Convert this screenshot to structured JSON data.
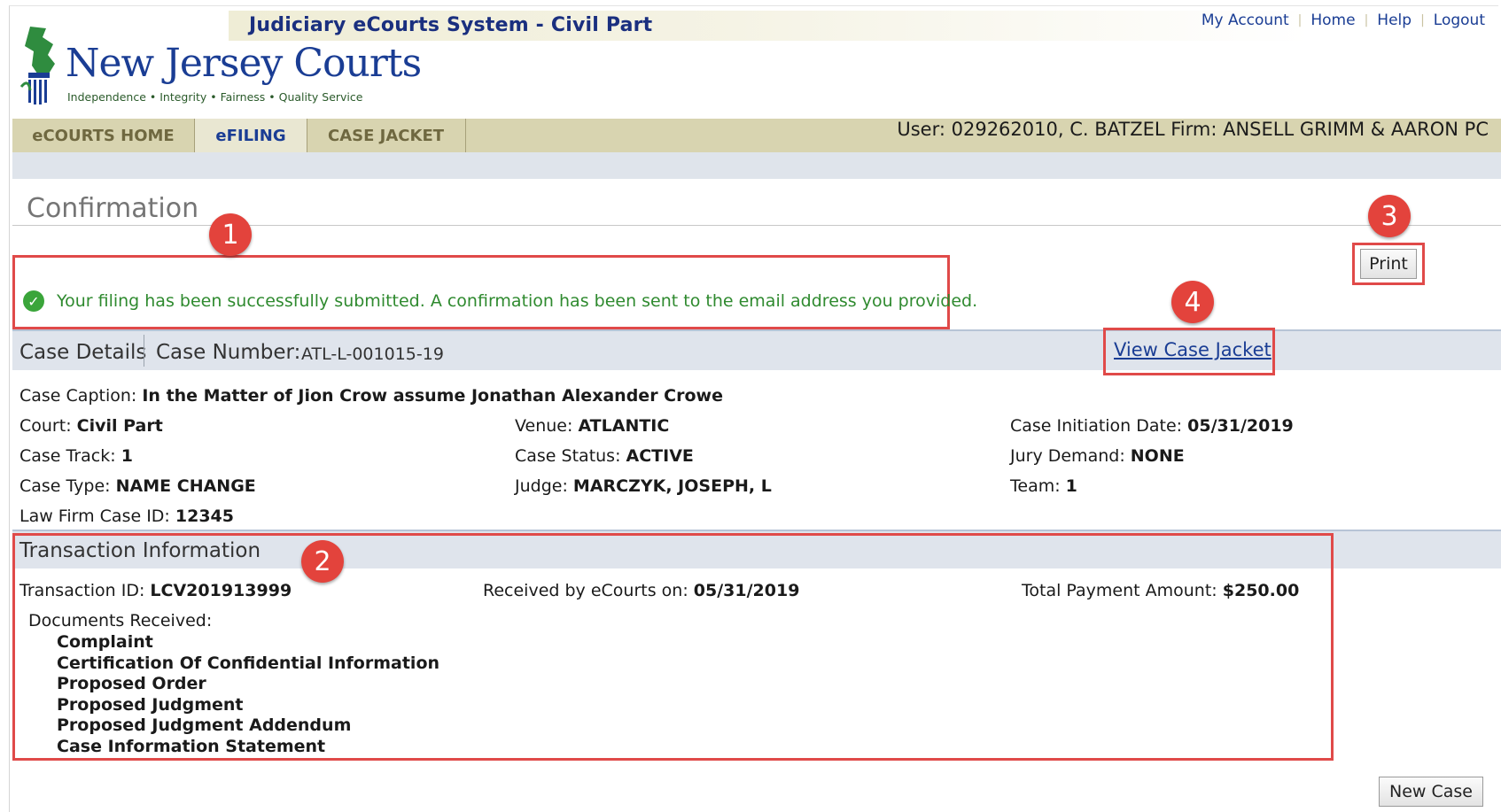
{
  "header": {
    "system_title": "Judiciary eCourts System - Civil Part",
    "links": [
      "My Account",
      "Home",
      "Help",
      "Logout"
    ]
  },
  "logo": {
    "name": "New Jersey Courts",
    "tagline": "Independence • Integrity • Fairness • Quality Service"
  },
  "nav": {
    "tabs": [
      {
        "label": "eCOURTS HOME"
      },
      {
        "label": "eFILING"
      },
      {
        "label": "CASE JACKET"
      }
    ],
    "active_tab": "eFILING",
    "user_info": "User: 029262010, C. BATZEL  Firm: ANSELL GRIMM & AARON PC"
  },
  "page": {
    "title": "Confirmation",
    "success_message": "Your filing has been successfully submitted. A confirmation has been sent to the email address you provided.",
    "print_label": "Print",
    "view_case_jacket_label": "View Case Jacket",
    "new_case_label": "New Case"
  },
  "callouts": [
    "1",
    "2",
    "3",
    "4"
  ],
  "case_details": {
    "section_label": "Case Details",
    "case_number_label": "Case Number:",
    "case_number": "ATL-L-001015-19",
    "caption_label": "Case Caption:",
    "caption": "In the Matter of Jion Crow assume Jonathan Alexander Crowe",
    "court_label": "Court:",
    "court": "Civil Part",
    "venue_label": "Venue:",
    "venue": "ATLANTIC",
    "initiation_label": "Case Initiation Date:",
    "initiation": "05/31/2019",
    "track_label": "Case Track:",
    "track": "1",
    "status_label": "Case Status:",
    "status": "ACTIVE",
    "jury_label": "Jury Demand:",
    "jury": "NONE",
    "type_label": "Case Type:",
    "type": "NAME CHANGE",
    "judge_label": "Judge:",
    "judge": "MARCZYK, JOSEPH, L",
    "team_label": "Team:",
    "team": "1",
    "firm_case_label": "Law Firm Case ID:",
    "firm_case": "12345"
  },
  "transaction": {
    "section_label": "Transaction Information",
    "id_label": "Transaction ID:",
    "id": "LCV201913999",
    "received_label": "Received by eCourts on:",
    "received": "05/31/2019",
    "payment_label": "Total Payment Amount:",
    "payment": "$250.00",
    "docs_label": "Documents Received:",
    "documents": [
      "Complaint",
      "Certification Of Confidential Information",
      "Proposed Order",
      "Proposed Judgment",
      "Proposed Judgment Addendum",
      "Case Information Statement"
    ]
  },
  "colors": {
    "callout_red": "#e3433c",
    "highlight_red": "#e04a49",
    "brand_blue": "#1a3d94",
    "success_green": "#2f8a2f"
  }
}
